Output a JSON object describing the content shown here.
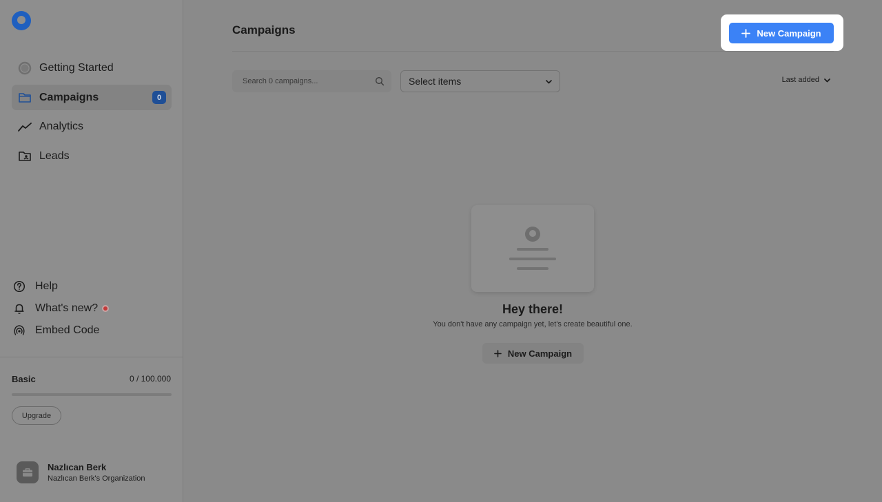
{
  "sidebar": {
    "nav": [
      {
        "label": "Getting Started",
        "icon": "progress-circle-icon"
      },
      {
        "label": "Campaigns",
        "icon": "folder-icon",
        "badge": "0",
        "active": true
      },
      {
        "label": "Analytics",
        "icon": "trend-line-icon"
      },
      {
        "label": "Leads",
        "icon": "contact-folder-icon"
      }
    ],
    "utility": [
      {
        "label": "Help",
        "icon": "help-icon"
      },
      {
        "label": "What's new?",
        "icon": "bell-icon",
        "has_dot": true
      },
      {
        "label": "Embed Code",
        "icon": "embed-broadcast-icon"
      }
    ],
    "plan": {
      "name": "Basic",
      "usage": "0 / 100.000",
      "progress": 0,
      "upgrade_label": "Upgrade"
    },
    "user": {
      "name": "Nazlıcan Berk",
      "organization": "Nazlıcan Berk's Organization",
      "avatar_icon": "briefcase-icon"
    }
  },
  "main": {
    "title": "Campaigns",
    "new_campaign_label": "New Campaign",
    "search": {
      "placeholder": "Search 0 campaigns..."
    },
    "filter": {
      "label": "Select items"
    },
    "sort": {
      "label": "Last added"
    },
    "empty_state": {
      "title": "Hey there!",
      "subtitle": "You don't have any campaign yet, let's create beautiful one.",
      "button_label": "New Campaign"
    }
  },
  "colors": {
    "accent": "#3b82f6",
    "badge": "#1f4f96",
    "logo": "#1f5fbf",
    "notification_dot": "#c33a3a"
  }
}
